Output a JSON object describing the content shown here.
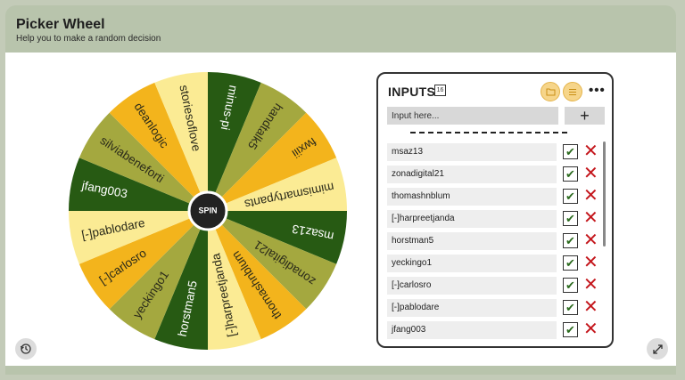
{
  "app": {
    "title": "Picker Wheel",
    "subtitle": "Help you to make a random decision"
  },
  "wheel": {
    "center_label": "SPIN",
    "colors": {
      "olive": "#a4a83f",
      "yellow": "#f3b41c",
      "pale": "#fbeb94",
      "dark": "#275a13"
    },
    "segments": [
      {
        "label": "minus-pi",
        "color": "dark"
      },
      {
        "label": "handtalk5",
        "color": "olive"
      },
      {
        "label": "fwxiii",
        "color": "yellow"
      },
      {
        "label": "mimismartypants",
        "color": "pale"
      },
      {
        "label": "msaz13",
        "color": "dark"
      },
      {
        "label": "zonadigital21",
        "color": "olive"
      },
      {
        "label": "thomashnblum",
        "color": "yellow"
      },
      {
        "label": "[-]harpreetjanda",
        "color": "pale"
      },
      {
        "label": "horstman5",
        "color": "dark"
      },
      {
        "label": "yeckingo1",
        "color": "olive"
      },
      {
        "label": "[-]carlosro",
        "color": "yellow"
      },
      {
        "label": "[-]pablodare",
        "color": "pale"
      },
      {
        "label": "jfang003",
        "color": "dark"
      },
      {
        "label": "silviabeneforti",
        "color": "olive"
      },
      {
        "label": "deanlogic",
        "color": "yellow"
      },
      {
        "label": "storiesoflove",
        "color": "pale"
      }
    ]
  },
  "inputs": {
    "title": "INPUTS",
    "count": "16",
    "placeholder": "Input here...",
    "add_icon": "+",
    "more_icon": "•••",
    "entries": [
      {
        "name": "msaz13"
      },
      {
        "name": "zonadigital21"
      },
      {
        "name": "thomashnblum"
      },
      {
        "name": " [-]harpreetjanda"
      },
      {
        "name": "horstman5"
      },
      {
        "name": "yeckingo1"
      },
      {
        "name": " [-]carlosro"
      },
      {
        "name": " [-]pablodare"
      },
      {
        "name": "jfang003"
      }
    ]
  },
  "icons": {
    "history": "history-icon",
    "fullscreen": "fullscreen-icon",
    "folder": "folder-icon",
    "list": "list-icon",
    "check": "✔",
    "remove": "✕"
  }
}
